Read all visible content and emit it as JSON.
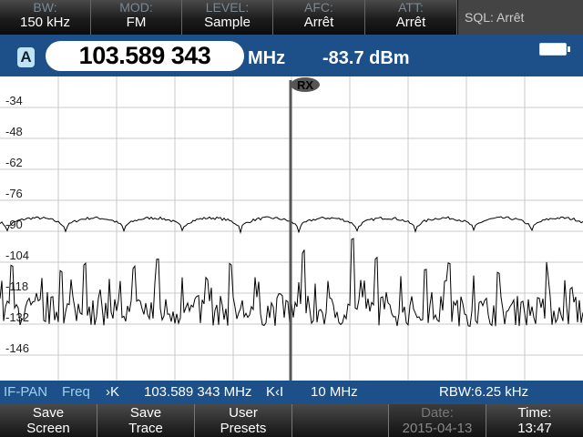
{
  "top_params": [
    {
      "label": "BW:",
      "value": "150 kHz"
    },
    {
      "label": "MOD:",
      "value": "FM"
    },
    {
      "label": "LEVEL:",
      "value": "Sample"
    },
    {
      "label": "AFC:",
      "value": "Arrêt"
    },
    {
      "label": "ATT:",
      "value": "Arrêt"
    }
  ],
  "sql": {
    "label": "SQL:",
    "value": "Arrêt"
  },
  "header": {
    "trace_badge": "A",
    "frequency": "103.589 343",
    "frequency_unit": "MHz",
    "level": "-83.7 dBm"
  },
  "marker": {
    "label": "RX"
  },
  "chart_data": {
    "type": "line",
    "yticks": [
      -34,
      -48,
      -62,
      -76,
      -90,
      -104,
      -118,
      -132,
      -146
    ],
    "ylabel_suffix": "",
    "center_frequency_mhz": 103.589343,
    "span_mhz": 10,
    "grid": true,
    "series": [
      {
        "kind": "max_hold",
        "baseline_dbm": -84,
        "dips_dbm": -90,
        "period_divisions": 1
      },
      {
        "kind": "live",
        "noise_floor_dbm": -126,
        "peaks_dbm": [
          -106,
          -118,
          -107,
          -104,
          -111,
          -106,
          -103,
          -110,
          -111,
          -106,
          -112,
          -117,
          -99,
          -111,
          -93,
          -102,
          -109,
          -106,
          -104,
          -110,
          -110,
          -122,
          -104,
          -115
        ]
      }
    ]
  },
  "infobar": {
    "mode": "IF-PAN",
    "freq_label": "Freq",
    "left_arrow": "›K",
    "center": "103.589 343 MHz",
    "right_arrow": "K‹I",
    "span": "10 MHz",
    "rbw": "RBW:6.25 kHz"
  },
  "softkeys": [
    {
      "l1": "Save",
      "l2": "Screen"
    },
    {
      "l1": "Save",
      "l2": "Trace"
    },
    {
      "l1": "User",
      "l2": "Presets"
    },
    {
      "l1": "",
      "l2": ""
    },
    {
      "l1": "Date:",
      "l2": "2015-04-13"
    },
    {
      "l1": "Time:",
      "l2": "13:47"
    }
  ],
  "colors": {
    "header_blue": "#1d4f89",
    "trace": "#000000",
    "plot_bg": "#ffffff",
    "grid": "#c8c8c8"
  }
}
